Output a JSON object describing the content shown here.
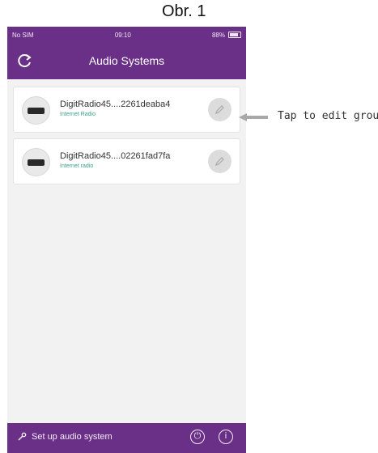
{
  "figure": {
    "caption": "Obr. 1"
  },
  "status_bar": {
    "carrier": "No SIM",
    "time": "09:10",
    "battery": "88%"
  },
  "header": {
    "title": "Audio Systems"
  },
  "devices": [
    {
      "name": "DigitRadio45....2261deaba4",
      "subtitle": "Internet Radio"
    },
    {
      "name": "DigitRadio45....02261fad7fa",
      "subtitle": "Internet radio"
    }
  ],
  "footer": {
    "setup_label": "Set up audio system",
    "power_symbol": "⏻",
    "info_symbol": "ⓘ"
  },
  "annotation": {
    "text": "Tap to edit group"
  },
  "colors": {
    "accent": "#6a2f87",
    "status_subtitle": "#3aa38a"
  },
  "icons": [
    "refresh-icon",
    "radio-device-icon",
    "pencil-icon",
    "wrench-icon",
    "power-icon",
    "info-icon",
    "arrow-icon"
  ]
}
